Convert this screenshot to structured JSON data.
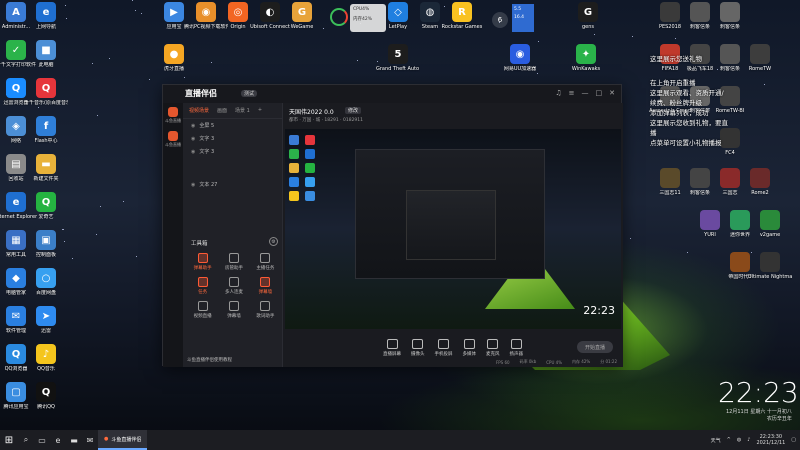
{
  "desktop": {
    "left_icons": [
      {
        "label": "Administr...",
        "color": "#3a7bd5",
        "glyph": "A"
      },
      {
        "label": "上网导航",
        "color": "#1f6fd1",
        "glyph": "e"
      },
      {
        "label": "千千文字打印软件",
        "color": "#2bb34a",
        "glyph": "✓"
      },
      {
        "label": "此电脑",
        "color": "#4c8fd6",
        "glyph": "■"
      },
      {
        "label": "迅雷浏览器",
        "color": "#1a8cff",
        "glyph": "Q"
      },
      {
        "label": "千千音乐(原百度音乐)",
        "color": "#e6353b",
        "glyph": "Q"
      },
      {
        "label": "网络",
        "color": "#4c8fd6",
        "glyph": "◈"
      },
      {
        "label": "Flash中心",
        "color": "#2f7fd8",
        "glyph": "f"
      },
      {
        "label": "回收站",
        "color": "#8a8a8a",
        "glyph": "▤"
      },
      {
        "label": "新建文件夹",
        "color": "#e8b23a",
        "glyph": "▬"
      },
      {
        "label": "Internet Explorer",
        "color": "#1f6fd1",
        "glyph": "e"
      },
      {
        "label": "爱奇艺",
        "color": "#25b341",
        "glyph": "Q"
      },
      {
        "label": "常用工具",
        "color": "#3a6fc4",
        "glyph": "▦"
      },
      {
        "label": "控制面板",
        "color": "#3b7fc8",
        "glyph": "▣"
      },
      {
        "label": "电脑管家",
        "color": "#2a7fe0",
        "glyph": "◆"
      },
      {
        "label": "百度网盘",
        "color": "#37a0f0",
        "glyph": "○"
      },
      {
        "label": "软件管理",
        "color": "#2a7fe0",
        "glyph": "✉"
      },
      {
        "label": "迅雷",
        "color": "#2e8bf0",
        "glyph": "➤"
      },
      {
        "label": "QQ浏览器",
        "color": "#2a8ae0",
        "glyph": "Q"
      },
      {
        "label": "QQ音乐",
        "color": "#f4c51d",
        "glyph": "♪"
      },
      {
        "label": "腾讯应用宝",
        "color": "#3a8de0",
        "glyph": "▢"
      },
      {
        "label": "腾讯QQ",
        "color": "#111111",
        "glyph": "Q"
      }
    ],
    "top_icons": [
      {
        "label": "应用宝",
        "color": "#3b86e0",
        "glyph": "▶"
      },
      {
        "label": "腾讯PC视频下载软件",
        "color": "#e88f2a",
        "glyph": "◉"
      },
      {
        "label": "Origin",
        "color": "#f26522",
        "glyph": "◎"
      },
      {
        "label": "Ubisoft Connect",
        "color": "#1d1d1d",
        "glyph": "◐"
      },
      {
        "label": "WeGame",
        "color": "#e8a33a",
        "glyph": "G"
      },
      {
        "label": "LetPlay",
        "color": "#1f7fe0",
        "glyph": "◇"
      },
      {
        "label": "Steam",
        "color": "#1b2838",
        "glyph": "◍"
      },
      {
        "label": "Rockstar Games",
        "color": "#f9c221",
        "glyph": "R"
      },
      {
        "label": "gens",
        "color": "#1d1d1d",
        "glyph": "G"
      },
      {
        "label": "虎牙直播",
        "color": "#f5a623",
        "glyph": "●"
      },
      {
        "label": "Grand Theft Auto V",
        "color": "#1d1d1d",
        "glyph": "5"
      },
      {
        "label": "网易UU加速器",
        "color": "#2a5de0",
        "glyph": "◉"
      },
      {
        "label": "WinKawaks",
        "color": "#2ab34a",
        "glyph": "✦"
      }
    ],
    "right_icons": [
      {
        "label": "PES2018",
        "color": "#3a3a3a"
      },
      {
        "label": "刺客信条",
        "color": "#555555"
      },
      {
        "label": "刺客信条",
        "color": "#666666"
      },
      {
        "label": "FIFA18",
        "color": "#c0392b"
      },
      {
        "label": "极品飞车18",
        "color": "#444444"
      },
      {
        "label": "刺客信条",
        "color": "#555555"
      },
      {
        "label": "RomeTW",
        "color": "#3d3d3d"
      },
      {
        "label": "Assassin's Creed",
        "color": "#555555"
      },
      {
        "label": "刺客信条",
        "color": "#666666"
      },
      {
        "label": "RomeTW-BI",
        "color": "#444444"
      },
      {
        "label": "FC4",
        "color": "#333333"
      },
      {
        "label": "三国志11",
        "color": "#5a4a2a"
      },
      {
        "label": "刺客信条",
        "color": "#444444"
      },
      {
        "label": "三国志",
        "color": "#8a2a2a"
      },
      {
        "label": "Rome2",
        "color": "#6a2a2a"
      },
      {
        "label": "YURI",
        "color": "#6a4aa0"
      },
      {
        "label": "迷你世界",
        "color": "#2a9a5a"
      },
      {
        "label": "v2game",
        "color": "#2a8a3a"
      },
      {
        "label": "帝国时代3",
        "color": "#8a4a1a"
      },
      {
        "label": "Ultimate Nightmare",
        "color": "#333333"
      }
    ]
  },
  "widgets": {
    "cpu_label": "CPU4%",
    "mem_label": "内存42%",
    "six_label": "6",
    "net_up": "5.5",
    "net_down": "16.4"
  },
  "overlay": {
    "lines": [
      "这里展示您送礼物",
      "在上角开启重播",
      "这里展示观看、资质开通/续费、粉丝牌升级",
      "添加弹幕列表，成功",
      "这里展示您收到礼物，要直播",
      "点菜单可设置小礼物播报"
    ]
  },
  "app_window": {
    "logo": "直播伴侣",
    "badge": "测试",
    "sidebar_items": [
      "斗鱼直播",
      "斗鱼直播"
    ],
    "tabs": [
      "视频场景",
      "画面",
      "场景 1"
    ],
    "scenes": [
      "全屏 5",
      "文字 3",
      "文字 3",
      "文本 27"
    ],
    "room_title": "天国伟2022 0.0",
    "room_btn": "修改",
    "room_sub": "都市 · 万国 · 城 · 18291 · 0182911",
    "tools_title": "工具箱",
    "tools": [
      {
        "label": "弹幕助手",
        "hot": true
      },
      {
        "label": "房管助手",
        "hot": false
      },
      {
        "label": "主播任务",
        "hot": false
      },
      {
        "label": "任务",
        "hot": true
      },
      {
        "label": "多人连麦",
        "hot": false
      },
      {
        "label": "弹幕墙",
        "hot": true
      },
      {
        "label": "视频直播",
        "hot": false
      },
      {
        "label": "弹幕墙",
        "hot": false
      },
      {
        "label": "歌词助手",
        "hot": false
      }
    ],
    "panel_footer": "斗鱼直播伴侣使用教程",
    "preview_clock": "22:23",
    "footer_buttons": [
      "直播屏幕",
      "摄像头",
      "手机投屏",
      "多媒体",
      "麦克风",
      "扬声器"
    ],
    "go_live": "开始直播",
    "stats": [
      "FPS 60",
      "码率 0kb",
      "CPU 4%",
      "内存 42%",
      "分 01:22"
    ]
  },
  "clock": {
    "time": "22:23",
    "date": "12月11日  星期六  十一月初八",
    "sub": "农历辛丑年"
  },
  "taskbar": {
    "app_label": "斗鱼直播伴侣",
    "tray_text": "天气",
    "time": "22:23:30",
    "date": "2021/12/11"
  }
}
